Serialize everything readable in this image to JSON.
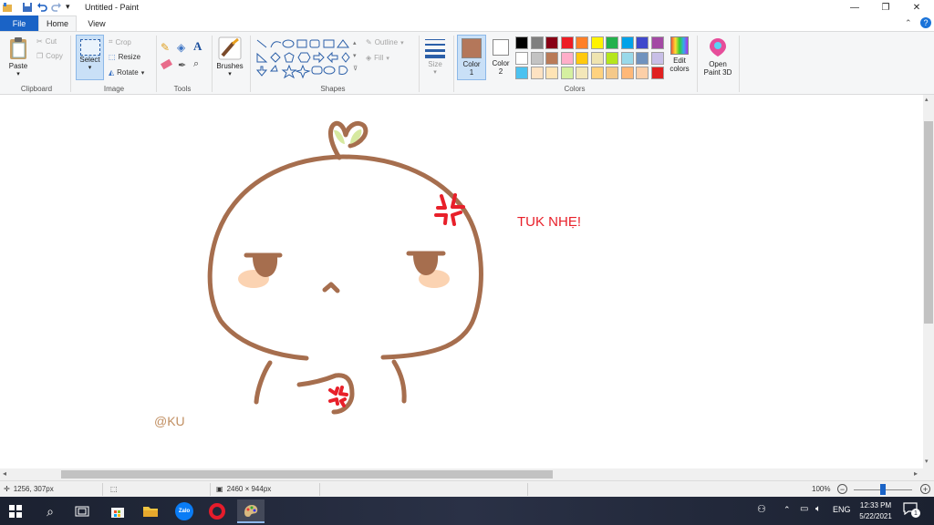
{
  "window": {
    "title": "Untitled - Paint"
  },
  "tabs": [
    {
      "label": "File"
    },
    {
      "label": "Home"
    },
    {
      "label": "View"
    }
  ],
  "ribbon": {
    "clipboard": {
      "group": "Clipboard",
      "paste": "Paste",
      "cut": "Cut",
      "copy": "Copy"
    },
    "image": {
      "group": "Image",
      "select": "Select",
      "crop": "Crop",
      "resize": "Resize",
      "rotate": "Rotate"
    },
    "tools": {
      "group": "Tools"
    },
    "brushes": {
      "label": "Brushes"
    },
    "shapes": {
      "group": "Shapes",
      "outline": "Outline",
      "fill": "Fill"
    },
    "size": {
      "label": "Size"
    },
    "colors": {
      "group": "Colors",
      "color1_label": "Color",
      "color1_num": "1",
      "color2_label": "Color",
      "color2_num": "2",
      "color1": "#b4775a",
      "color2": "#ffffff",
      "edit_colors_1": "Edit",
      "edit_colors_2": "colors",
      "palette": [
        "#000000",
        "#7f7f7f",
        "#880015",
        "#ed1c24",
        "#ff7f27",
        "#fff200",
        "#22b14c",
        "#00a2e8",
        "#3f48cc",
        "#a349a4",
        "#ffffff",
        "#c3c3c3",
        "#b97a57",
        "#ffaec9",
        "#ffc90e",
        "#efe4b0",
        "#b5e61d",
        "#99d9ea",
        "#7092be",
        "#c8bfe7",
        "#4cc2f0",
        "#fde2c2",
        "#ffe4b5",
        "#d5f0a0",
        "#f3e7b9",
        "#ffd27f",
        "#f5c98a",
        "#ffb878",
        "#fccfa8",
        "#e02020"
      ]
    },
    "paint3d": {
      "line1": "Open",
      "line2": "Paint 3D"
    }
  },
  "canvas": {
    "text_main": "TUK NHẸ!",
    "text_signature": "@KU",
    "stroke_color": "#a66e4e",
    "anger_color": "#e8202a",
    "blush_color": "#fbd3b2",
    "sprout_color": "#d6e9a0"
  },
  "status": {
    "cursor_pos": "1256, 307px",
    "canvas_size": "2460 × 944px",
    "zoom": "100%"
  },
  "taskbar": {
    "zalo_label": "Zalo",
    "lang": "ENG",
    "time": "12:33 PM",
    "date": "5/22/2021",
    "notif_count": "1"
  }
}
